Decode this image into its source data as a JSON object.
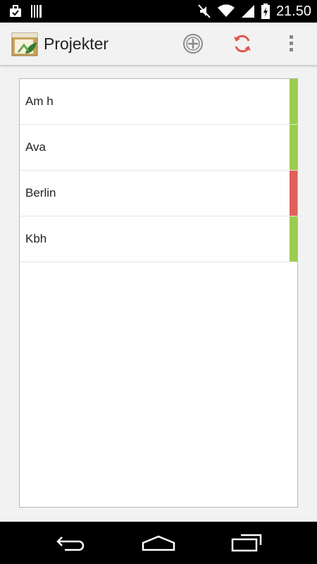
{
  "status_bar": {
    "time": "21.50",
    "icons": [
      "briefcase-check-icon",
      "barcode-icon",
      "mute-icon",
      "wifi-icon",
      "signal-icon",
      "battery-charging-icon"
    ]
  },
  "action_bar": {
    "title": "Projekter",
    "app_icon": "reporter-app-icon",
    "actions": [
      "add-circle-icon",
      "refresh-icon",
      "overflow-menu-icon"
    ]
  },
  "projects": [
    {
      "name": "Am h",
      "status_color": "#9ccc4e"
    },
    {
      "name": "Ava",
      "status_color": "#9ccc4e"
    },
    {
      "name": "Berlin",
      "status_color": "#e0605a"
    },
    {
      "name": "Kbh",
      "status_color": "#9ccc4e"
    }
  ],
  "colors": {
    "refresh_accent": "#e2584f",
    "status_ok": "#9ccc4e",
    "status_alert": "#e0605a"
  },
  "nav_bar": {
    "buttons": [
      "back-icon",
      "home-icon",
      "recents-icon"
    ]
  }
}
